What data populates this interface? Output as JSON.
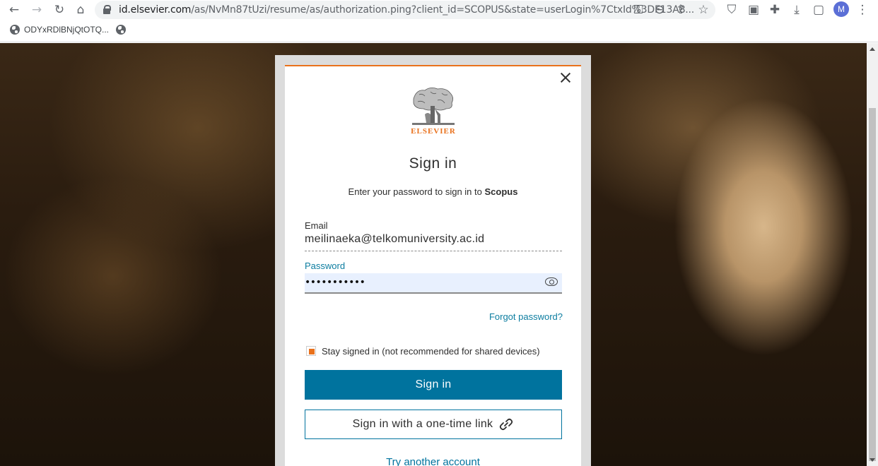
{
  "browser": {
    "url_host": "id.elsevier.com",
    "url_path": "/as/NvMn87tUzi/resume/as/authorization.ping?client_id=SCOPUS&state=userLogin%7CtxId%3DF13A8...",
    "avatar_initial": "M",
    "icons": [
      "back-icon",
      "forward-icon",
      "reload-icon",
      "home-icon",
      "key-icon",
      "zoom-icon",
      "share-icon",
      "star-icon",
      "shield-icon",
      "mendeley-icon",
      "extensions-icon",
      "download-icon",
      "sidepanel-icon",
      "menu-icon"
    ]
  },
  "bookmarks": {
    "item1": "ODYxRDlBNjQtOTQ..."
  },
  "modal": {
    "logo_text": "ELSEVIER",
    "title": "Sign in",
    "subtitle_prefix": "Enter your password to sign in to ",
    "subtitle_app": "Scopus",
    "email_label": "Email",
    "email_value": "meilinaeka@telkomuniversity.ac.id",
    "password_label": "Password",
    "password_value": "•••••••••••",
    "forgot_password": "Forgot password?",
    "stay_signed_in": "Stay signed in (not recommended for shared devices)",
    "stay_signed_in_checked": true,
    "sign_in_button": "Sign in",
    "one_time_link_button": "Sign in with a one-time link",
    "try_another_account": "Try another account"
  },
  "colors": {
    "accent_orange": "#e9711c",
    "primary_blue": "#00739e",
    "link_blue": "#0c7da0"
  }
}
